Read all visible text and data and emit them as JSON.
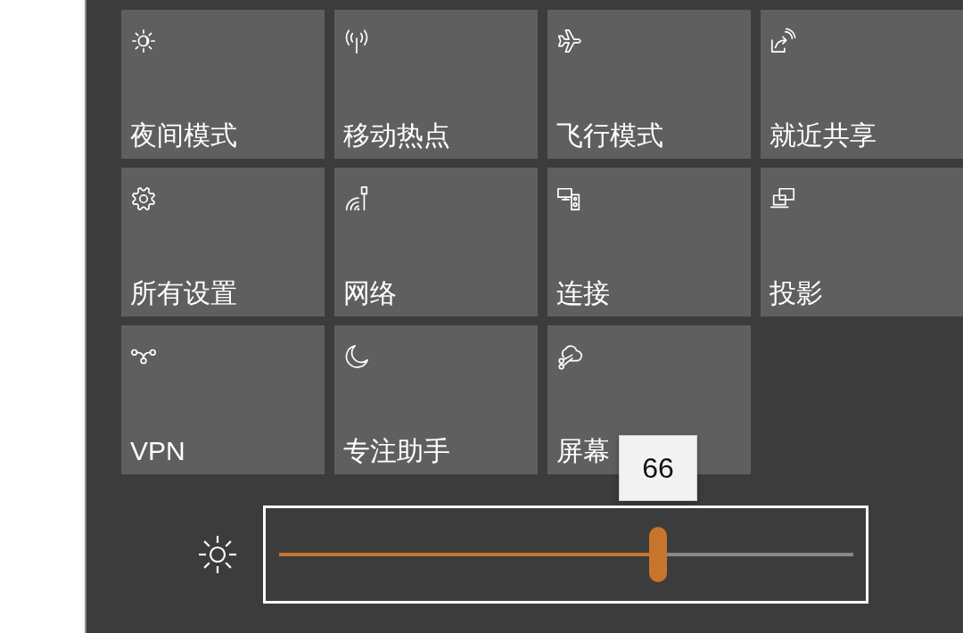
{
  "tiles": [
    {
      "label": "夜间模式",
      "on": false
    },
    {
      "label": "移动热点",
      "on": false
    },
    {
      "label": "飞行模式",
      "on": false
    },
    {
      "label": "就近共享",
      "on": false
    },
    {
      "label": "所有设置",
      "on": false
    },
    {
      "label": "网络",
      "on": false
    },
    {
      "label": "连接",
      "on": false
    },
    {
      "label": "投影",
      "on": false
    },
    {
      "label": "VPN",
      "on": false
    },
    {
      "label": "专注助手",
      "on": false
    },
    {
      "label": "屏幕",
      "on": false
    }
  ],
  "brightness": {
    "level": 0.66,
    "reading": "66",
    "focused": true
  }
}
